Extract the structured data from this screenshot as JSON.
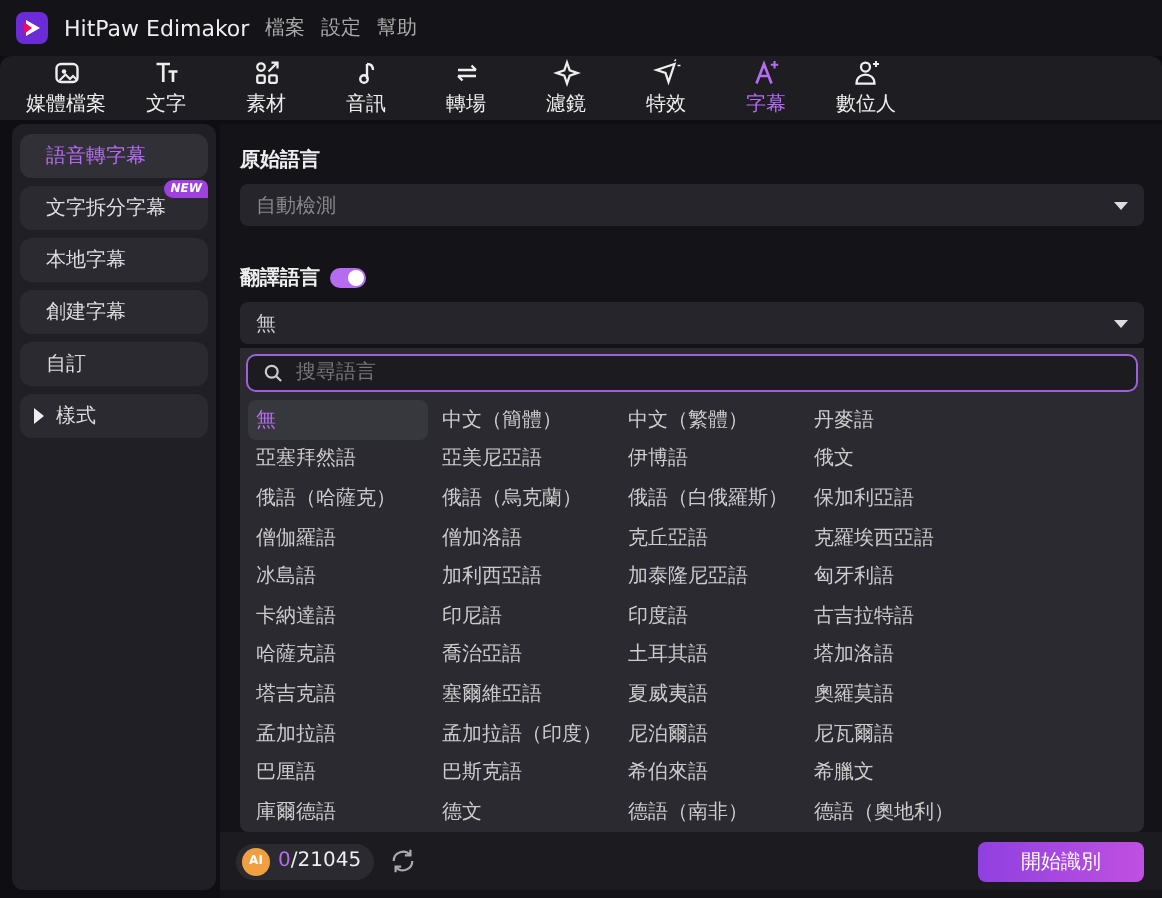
{
  "app": {
    "title": "HitPaw Edimakor",
    "menu": [
      "檔案",
      "設定",
      "幫助"
    ]
  },
  "toolbar": [
    {
      "label": "媒體檔案",
      "selected": false
    },
    {
      "label": "文字",
      "selected": false
    },
    {
      "label": "素材",
      "selected": false
    },
    {
      "label": "音訊",
      "selected": false
    },
    {
      "label": "轉場",
      "selected": false
    },
    {
      "label": "濾鏡",
      "selected": false
    },
    {
      "label": "特效",
      "selected": false
    },
    {
      "label": "字幕",
      "selected": true
    },
    {
      "label": "數位人",
      "selected": false
    }
  ],
  "sidebar": [
    {
      "label": "語音轉字幕",
      "selected": true,
      "kind": "item"
    },
    {
      "label": "文字拆分字幕",
      "selected": false,
      "kind": "item",
      "badge": "NEW"
    },
    {
      "label": "本地字幕",
      "selected": false,
      "kind": "item"
    },
    {
      "label": "創建字幕",
      "selected": false,
      "kind": "item"
    },
    {
      "label": "自訂",
      "selected": false,
      "kind": "item"
    },
    {
      "label": "樣式",
      "selected": false,
      "kind": "group",
      "expanded": false
    }
  ],
  "source_language": {
    "label": "原始語言",
    "value": "自動檢測"
  },
  "target_language": {
    "label": "翻譯語言",
    "enabled": true,
    "value": "無",
    "search": {
      "placeholder": "搜尋語言"
    },
    "options": [
      {
        "label": "無",
        "selected": true
      },
      {
        "label": "中文（簡體）",
        "selected": false
      },
      {
        "label": "中文（繁體）",
        "selected": false
      },
      {
        "label": "丹麥語",
        "selected": false
      },
      {
        "label": "亞塞拜然語",
        "selected": false
      },
      {
        "label": "亞美尼亞語",
        "selected": false
      },
      {
        "label": "伊博語",
        "selected": false
      },
      {
        "label": "俄文",
        "selected": false
      },
      {
        "label": "俄語（哈薩克）",
        "selected": false
      },
      {
        "label": "俄語（烏克蘭）",
        "selected": false
      },
      {
        "label": "俄語（白俄羅斯）",
        "selected": false
      },
      {
        "label": "保加利亞語",
        "selected": false
      },
      {
        "label": "僧伽羅語",
        "selected": false
      },
      {
        "label": "僧加洛語",
        "selected": false
      },
      {
        "label": "克丘亞語",
        "selected": false
      },
      {
        "label": "克羅埃西亞語",
        "selected": false
      },
      {
        "label": "冰島語",
        "selected": false
      },
      {
        "label": "加利西亞語",
        "selected": false
      },
      {
        "label": "加泰隆尼亞語",
        "selected": false
      },
      {
        "label": "匈牙利語",
        "selected": false
      },
      {
        "label": "卡納達語",
        "selected": false
      },
      {
        "label": "印尼語",
        "selected": false
      },
      {
        "label": "印度語",
        "selected": false
      },
      {
        "label": "古吉拉特語",
        "selected": false
      },
      {
        "label": "哈薩克語",
        "selected": false
      },
      {
        "label": "喬治亞語",
        "selected": false
      },
      {
        "label": "土耳其語",
        "selected": false
      },
      {
        "label": "塔加洛語",
        "selected": false
      },
      {
        "label": "塔吉克語",
        "selected": false
      },
      {
        "label": "塞爾維亞語",
        "selected": false
      },
      {
        "label": "夏威夷語",
        "selected": false
      },
      {
        "label": "奧羅莫語",
        "selected": false
      },
      {
        "label": "孟加拉語",
        "selected": false
      },
      {
        "label": "孟加拉語（印度）",
        "selected": false
      },
      {
        "label": "尼泊爾語",
        "selected": false
      },
      {
        "label": "尼瓦爾語",
        "selected": false
      },
      {
        "label": "巴厘語",
        "selected": false
      },
      {
        "label": "巴斯克語",
        "selected": false
      },
      {
        "label": "希伯來語",
        "selected": false
      },
      {
        "label": "希臘文",
        "selected": false
      },
      {
        "label": "庫爾德語",
        "selected": false
      },
      {
        "label": "德文",
        "selected": false
      },
      {
        "label": "德語（南非）",
        "selected": false
      },
      {
        "label": "德語（奧地利）",
        "selected": false
      }
    ]
  },
  "footer": {
    "ai_badge": "AI",
    "credits_used": "0",
    "credits_total": "/21045",
    "start_button": "開始識別"
  }
}
